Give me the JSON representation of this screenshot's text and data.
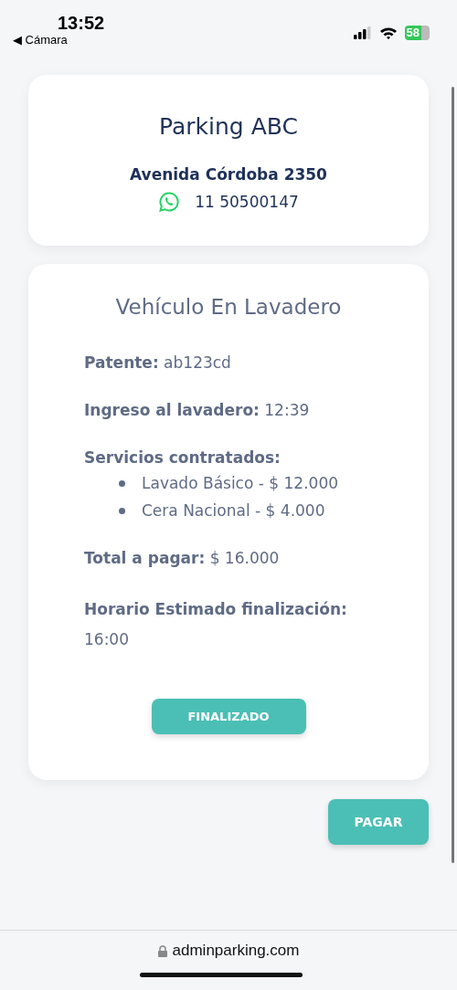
{
  "status_bar": {
    "time": "13:52",
    "back_label": "◀ Cámara",
    "battery": "58"
  },
  "header_card": {
    "title": "Parking ABC",
    "address": "Avenida Córdoba 2350",
    "phone": "11 50500147"
  },
  "vehicle_card": {
    "title": "Vehículo En Lavadero",
    "fields": [
      {
        "label": "Patente:",
        "value": "ab123cd",
        "kind": "inline"
      },
      {
        "label": "Ingreso al lavadero:",
        "value": "12:39",
        "kind": "inline"
      },
      {
        "label": "Servicios contratados:",
        "items": [
          "Lavado Básico - $ 12.000",
          "Cera Nacional - $ 4.000"
        ],
        "kind": "list"
      },
      {
        "label": "Total a pagar:",
        "value": "$ 16.000",
        "kind": "inline"
      },
      {
        "label": "Horario Estimado finalización:",
        "value": "16:00",
        "kind": "block"
      }
    ],
    "button": "FINALIZADO"
  },
  "pay_button": "PAGAR",
  "browser_bar": {
    "url": "adminparking.com"
  }
}
